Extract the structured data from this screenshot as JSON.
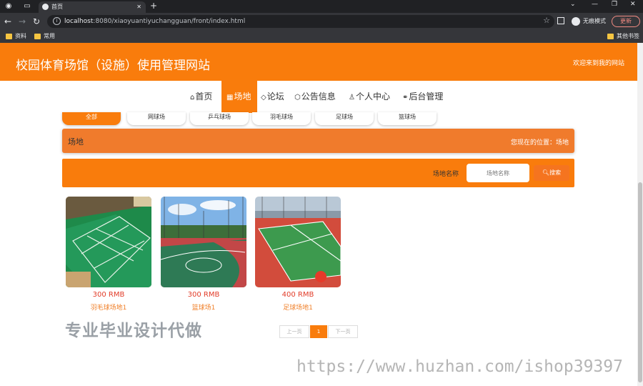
{
  "browser": {
    "tab_title": "首页",
    "url_host": "localhost",
    "url_rest": ":8080/xiaoyuantiyuchangguan/front/index.html",
    "incognito_label": "无痕模式",
    "update_label": "更新",
    "bookmarks": [
      "资料",
      "常用"
    ],
    "other_bookmarks": "其他书签"
  },
  "header": {
    "title": "校园体育场馆（设施）使用管理网站",
    "welcome": "欢迎来到我的网站"
  },
  "nav": {
    "items": [
      {
        "label": "首页",
        "icon": "home-icon",
        "glyph": "⌂"
      },
      {
        "label": "场地",
        "icon": "grid-icon",
        "glyph": "▦"
      },
      {
        "label": "论坛",
        "icon": "tag-icon",
        "glyph": "◇"
      },
      {
        "label": "公告信息",
        "icon": "cube-icon",
        "glyph": "⬡"
      },
      {
        "label": "个人中心",
        "icon": "user-icon",
        "glyph": "♙"
      },
      {
        "label": "后台管理",
        "icon": "link-icon",
        "glyph": "⚭"
      }
    ],
    "active_index": 1
  },
  "categories": [
    "全部",
    "网球场",
    "乒乓球场",
    "羽毛球场",
    "足球场",
    "篮球场"
  ],
  "breadcrumb": {
    "section": "场地",
    "location": "您现在的位置：场地"
  },
  "search": {
    "label": "场地名称",
    "placeholder": "场地名称",
    "button": "搜索"
  },
  "venues": [
    {
      "price": "300 RMB",
      "name": "羽毛球场地1"
    },
    {
      "price": "300 RMB",
      "name": "篮球场1"
    },
    {
      "price": "400 RMB",
      "name": "足球场地1"
    }
  ],
  "pager": {
    "prev": "上一页",
    "current": "1",
    "next": "下一页"
  },
  "watermarks": {
    "promo": "专业毕业设计代做",
    "url": "https://www.huzhan.com/ishop39397"
  },
  "colors": {
    "primary": "#f97c0c",
    "price": "#e23c28",
    "name": "#f0802a"
  }
}
